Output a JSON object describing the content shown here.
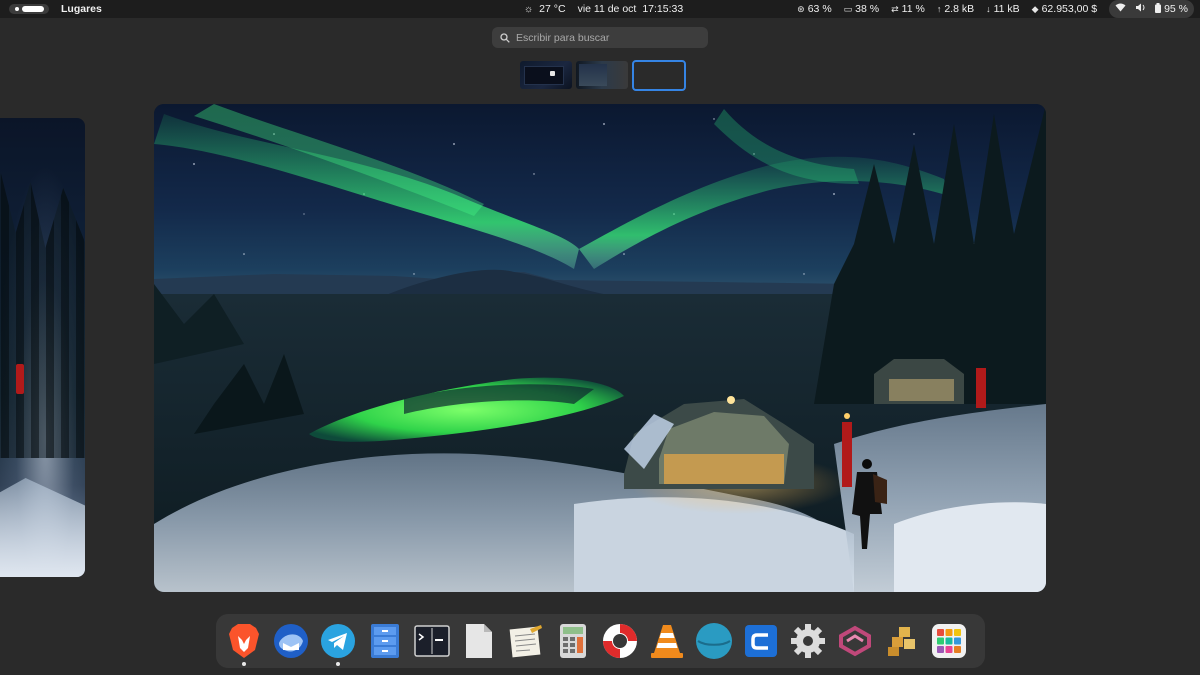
{
  "topbar": {
    "places_label": "Lugares",
    "weather": "27 °C",
    "date": "vie 11 de oct",
    "time": "17:15:33",
    "cpu": "63 %",
    "memory": "38 %",
    "swap": "11 %",
    "upload": "2.8 kB",
    "download": "11 kB",
    "balance": "62.953,00 $",
    "battery": "95 %"
  },
  "search": {
    "placeholder": "Escribir para buscar"
  },
  "workspaces": {
    "count": 3,
    "active_index": 2
  },
  "dock": {
    "apps": [
      {
        "name": "Brave",
        "icon": "brave-lion-icon",
        "running": true
      },
      {
        "name": "Thunderbird",
        "icon": "thunderbird-icon",
        "running": false
      },
      {
        "name": "Telegram",
        "icon": "telegram-icon",
        "running": true
      },
      {
        "name": "Archivos",
        "icon": "file-cabinet-icon",
        "running": false
      },
      {
        "name": "Terminal",
        "icon": "terminal-icon",
        "running": false
      },
      {
        "name": "Documento",
        "icon": "document-icon",
        "running": false
      },
      {
        "name": "Editor de texto",
        "icon": "text-editor-icon",
        "running": false
      },
      {
        "name": "Calculadora",
        "icon": "calculator-icon",
        "running": false
      },
      {
        "name": "Lifebuoy",
        "icon": "lifebuoy-icon",
        "running": false
      },
      {
        "name": "VLC",
        "icon": "vlc-cone-icon",
        "running": false
      },
      {
        "name": "Globe",
        "icon": "globe-icon",
        "running": false
      },
      {
        "name": "CCleaner",
        "icon": "ccleaner-icon",
        "running": false
      },
      {
        "name": "Configuración",
        "icon": "gear-icon",
        "running": false
      },
      {
        "name": "Sync",
        "icon": "sync-arrows-icon",
        "running": false
      },
      {
        "name": "Paquetes",
        "icon": "packages-icon",
        "running": false
      },
      {
        "name": "Aplicaciones",
        "icon": "app-grid-icon",
        "running": false
      }
    ]
  },
  "colors": {
    "accent": "#3584e4",
    "topbar_bg": "#1d1d1d",
    "overview_bg": "#2a2a2a",
    "dock_bg": "#383838"
  }
}
